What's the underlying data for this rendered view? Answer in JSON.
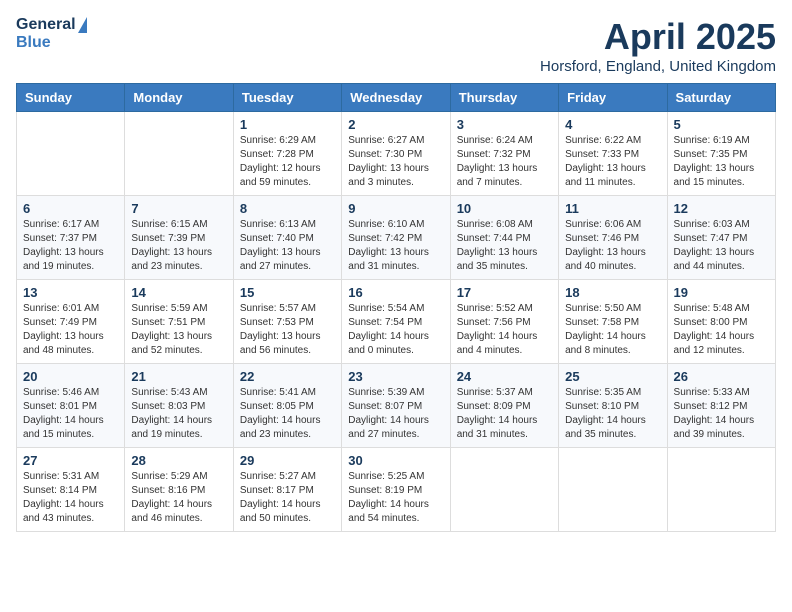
{
  "header": {
    "logo_line1": "General",
    "logo_line2": "Blue",
    "month": "April 2025",
    "location": "Horsford, England, United Kingdom"
  },
  "days_of_week": [
    "Sunday",
    "Monday",
    "Tuesday",
    "Wednesday",
    "Thursday",
    "Friday",
    "Saturday"
  ],
  "weeks": [
    [
      {
        "day": "",
        "sunrise": "",
        "sunset": "",
        "daylight": ""
      },
      {
        "day": "",
        "sunrise": "",
        "sunset": "",
        "daylight": ""
      },
      {
        "day": "1",
        "sunrise": "Sunrise: 6:29 AM",
        "sunset": "Sunset: 7:28 PM",
        "daylight": "Daylight: 12 hours and 59 minutes."
      },
      {
        "day": "2",
        "sunrise": "Sunrise: 6:27 AM",
        "sunset": "Sunset: 7:30 PM",
        "daylight": "Daylight: 13 hours and 3 minutes."
      },
      {
        "day": "3",
        "sunrise": "Sunrise: 6:24 AM",
        "sunset": "Sunset: 7:32 PM",
        "daylight": "Daylight: 13 hours and 7 minutes."
      },
      {
        "day": "4",
        "sunrise": "Sunrise: 6:22 AM",
        "sunset": "Sunset: 7:33 PM",
        "daylight": "Daylight: 13 hours and 11 minutes."
      },
      {
        "day": "5",
        "sunrise": "Sunrise: 6:19 AM",
        "sunset": "Sunset: 7:35 PM",
        "daylight": "Daylight: 13 hours and 15 minutes."
      }
    ],
    [
      {
        "day": "6",
        "sunrise": "Sunrise: 6:17 AM",
        "sunset": "Sunset: 7:37 PM",
        "daylight": "Daylight: 13 hours and 19 minutes."
      },
      {
        "day": "7",
        "sunrise": "Sunrise: 6:15 AM",
        "sunset": "Sunset: 7:39 PM",
        "daylight": "Daylight: 13 hours and 23 minutes."
      },
      {
        "day": "8",
        "sunrise": "Sunrise: 6:13 AM",
        "sunset": "Sunset: 7:40 PM",
        "daylight": "Daylight: 13 hours and 27 minutes."
      },
      {
        "day": "9",
        "sunrise": "Sunrise: 6:10 AM",
        "sunset": "Sunset: 7:42 PM",
        "daylight": "Daylight: 13 hours and 31 minutes."
      },
      {
        "day": "10",
        "sunrise": "Sunrise: 6:08 AM",
        "sunset": "Sunset: 7:44 PM",
        "daylight": "Daylight: 13 hours and 35 minutes."
      },
      {
        "day": "11",
        "sunrise": "Sunrise: 6:06 AM",
        "sunset": "Sunset: 7:46 PM",
        "daylight": "Daylight: 13 hours and 40 minutes."
      },
      {
        "day": "12",
        "sunrise": "Sunrise: 6:03 AM",
        "sunset": "Sunset: 7:47 PM",
        "daylight": "Daylight: 13 hours and 44 minutes."
      }
    ],
    [
      {
        "day": "13",
        "sunrise": "Sunrise: 6:01 AM",
        "sunset": "Sunset: 7:49 PM",
        "daylight": "Daylight: 13 hours and 48 minutes."
      },
      {
        "day": "14",
        "sunrise": "Sunrise: 5:59 AM",
        "sunset": "Sunset: 7:51 PM",
        "daylight": "Daylight: 13 hours and 52 minutes."
      },
      {
        "day": "15",
        "sunrise": "Sunrise: 5:57 AM",
        "sunset": "Sunset: 7:53 PM",
        "daylight": "Daylight: 13 hours and 56 minutes."
      },
      {
        "day": "16",
        "sunrise": "Sunrise: 5:54 AM",
        "sunset": "Sunset: 7:54 PM",
        "daylight": "Daylight: 14 hours and 0 minutes."
      },
      {
        "day": "17",
        "sunrise": "Sunrise: 5:52 AM",
        "sunset": "Sunset: 7:56 PM",
        "daylight": "Daylight: 14 hours and 4 minutes."
      },
      {
        "day": "18",
        "sunrise": "Sunrise: 5:50 AM",
        "sunset": "Sunset: 7:58 PM",
        "daylight": "Daylight: 14 hours and 8 minutes."
      },
      {
        "day": "19",
        "sunrise": "Sunrise: 5:48 AM",
        "sunset": "Sunset: 8:00 PM",
        "daylight": "Daylight: 14 hours and 12 minutes."
      }
    ],
    [
      {
        "day": "20",
        "sunrise": "Sunrise: 5:46 AM",
        "sunset": "Sunset: 8:01 PM",
        "daylight": "Daylight: 14 hours and 15 minutes."
      },
      {
        "day": "21",
        "sunrise": "Sunrise: 5:43 AM",
        "sunset": "Sunset: 8:03 PM",
        "daylight": "Daylight: 14 hours and 19 minutes."
      },
      {
        "day": "22",
        "sunrise": "Sunrise: 5:41 AM",
        "sunset": "Sunset: 8:05 PM",
        "daylight": "Daylight: 14 hours and 23 minutes."
      },
      {
        "day": "23",
        "sunrise": "Sunrise: 5:39 AM",
        "sunset": "Sunset: 8:07 PM",
        "daylight": "Daylight: 14 hours and 27 minutes."
      },
      {
        "day": "24",
        "sunrise": "Sunrise: 5:37 AM",
        "sunset": "Sunset: 8:09 PM",
        "daylight": "Daylight: 14 hours and 31 minutes."
      },
      {
        "day": "25",
        "sunrise": "Sunrise: 5:35 AM",
        "sunset": "Sunset: 8:10 PM",
        "daylight": "Daylight: 14 hours and 35 minutes."
      },
      {
        "day": "26",
        "sunrise": "Sunrise: 5:33 AM",
        "sunset": "Sunset: 8:12 PM",
        "daylight": "Daylight: 14 hours and 39 minutes."
      }
    ],
    [
      {
        "day": "27",
        "sunrise": "Sunrise: 5:31 AM",
        "sunset": "Sunset: 8:14 PM",
        "daylight": "Daylight: 14 hours and 43 minutes."
      },
      {
        "day": "28",
        "sunrise": "Sunrise: 5:29 AM",
        "sunset": "Sunset: 8:16 PM",
        "daylight": "Daylight: 14 hours and 46 minutes."
      },
      {
        "day": "29",
        "sunrise": "Sunrise: 5:27 AM",
        "sunset": "Sunset: 8:17 PM",
        "daylight": "Daylight: 14 hours and 50 minutes."
      },
      {
        "day": "30",
        "sunrise": "Sunrise: 5:25 AM",
        "sunset": "Sunset: 8:19 PM",
        "daylight": "Daylight: 14 hours and 54 minutes."
      },
      {
        "day": "",
        "sunrise": "",
        "sunset": "",
        "daylight": ""
      },
      {
        "day": "",
        "sunrise": "",
        "sunset": "",
        "daylight": ""
      },
      {
        "day": "",
        "sunrise": "",
        "sunset": "",
        "daylight": ""
      }
    ]
  ]
}
